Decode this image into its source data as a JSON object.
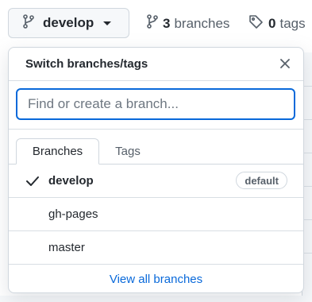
{
  "toolbar": {
    "current_branch": "develop",
    "branches_count": "3",
    "branches_label": "branches",
    "tags_count": "0",
    "tags_label": "tags"
  },
  "popover": {
    "title": "Switch branches/tags",
    "search_placeholder": "Find or create a branch...",
    "tabs": [
      {
        "label": "Branches",
        "active": true
      },
      {
        "label": "Tags",
        "active": false
      }
    ],
    "branches": [
      {
        "name": "develop",
        "selected": true,
        "badge": "default"
      },
      {
        "name": "gh-pages",
        "selected": false
      },
      {
        "name": "master",
        "selected": false
      }
    ],
    "view_all": "View all branches"
  },
  "icons": {
    "branch": "git-branch-icon",
    "tag": "tag-icon",
    "close": "x-icon",
    "check": "check-icon",
    "caret": "triangle-down-icon"
  },
  "colors": {
    "accent": "#0969da",
    "text": "#24292f",
    "muted": "#57606a",
    "border": "#d0d7de"
  }
}
